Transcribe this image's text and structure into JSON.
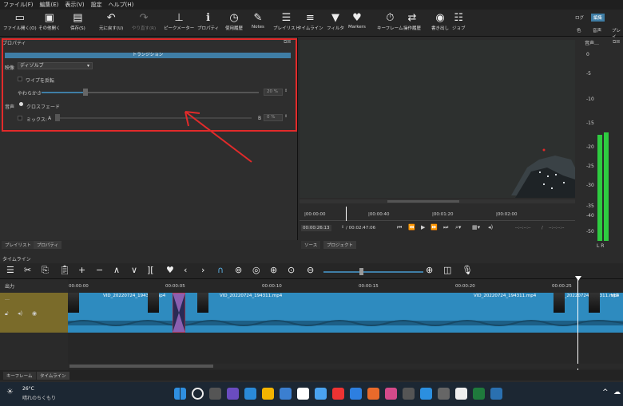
{
  "menu": [
    "ファイル(F)",
    "編集(E)",
    "表示(V)",
    "設定",
    "ヘルプ(H)"
  ],
  "toolbar": [
    {
      "label": "ファイル開く(O)",
      "icon": "folder-icon",
      "ch": "▭"
    },
    {
      "label": "その他開く",
      "icon": "open-other-icon",
      "ch": "▣"
    },
    {
      "label": "保存(S)",
      "icon": "save-icon",
      "ch": "▤"
    },
    {
      "label": "元に戻す(U)",
      "icon": "undo-icon",
      "ch": "↶"
    },
    {
      "label": "やり直す(R)",
      "icon": "redo-icon",
      "ch": "↷"
    },
    {
      "label": "ピークメーター",
      "icon": "peak-meter-icon",
      "ch": "⊥"
    },
    {
      "label": "プロパティ",
      "icon": "properties-icon",
      "ch": "ℹ"
    },
    {
      "label": "使用履歴",
      "icon": "history-icon",
      "ch": "◷"
    },
    {
      "label": "Notes",
      "icon": "notes-icon",
      "ch": "✎"
    },
    {
      "label": "プレイリスト",
      "icon": "playlist-icon",
      "ch": "☰"
    },
    {
      "label": "タイムライン",
      "icon": "timeline-icon",
      "ch": "≡"
    },
    {
      "label": "フィルタ",
      "icon": "filter-icon",
      "ch": "▼"
    },
    {
      "label": "Markers",
      "icon": "markers-icon",
      "ch": "♥"
    },
    {
      "label": "キーフレーム",
      "icon": "keyframe-icon",
      "ch": "⏱"
    },
    {
      "label": "操作履歴",
      "icon": "jobs-history-icon",
      "ch": "⇄"
    },
    {
      "label": "書き出し",
      "icon": "export-icon",
      "ch": "◉"
    },
    {
      "label": "ジョブ",
      "icon": "jobs-icon",
      "ch": "☷"
    }
  ],
  "layout_tabs": {
    "log": "ログ",
    "edit": "編集",
    "color": "色",
    "audio": "音声",
    "player": "プレイ"
  },
  "props": {
    "title": "プロパティ",
    "header": "トランジション",
    "video_label": "映像",
    "dissolve": "ディゾルブ",
    "invert": "ワイプを反転",
    "softness": "やわらかさ",
    "softness_value": "20 %",
    "audio_label": "音声",
    "crossfade": "クロスフェード",
    "mix": "ミックス:",
    "mix_a": "A",
    "mix_b": "B",
    "mix_value": "0 %"
  },
  "meter": {
    "title": "音声…",
    "labels": [
      "0",
      "-5",
      "-10",
      "-15",
      "-20",
      "-25",
      "-30",
      "-35",
      "-40",
      "-50"
    ],
    "lr": "L  R",
    "levels": [
      0.78,
      0.8
    ]
  },
  "player_ruler": [
    "00:00:00",
    "00:00:40",
    "00:01:20",
    "00:02:00"
  ],
  "transport": {
    "position": "00:00:26:13",
    "duration": "/ 00:02:47:06",
    "in": "--:--:--:--",
    "out": "--:--:--:--",
    "sep": "/"
  },
  "left_tabs": [
    "プレイリスト",
    "プロパティ"
  ],
  "right_tabs": [
    "ソース",
    "プロジェクト"
  ],
  "timeline": {
    "title": "タイムライン",
    "output": "出力",
    "ruler": [
      "00:00:00",
      "00:00:05",
      "00:00:10",
      "00:00:15",
      "00:00:20",
      "00:00:25"
    ],
    "clips": [
      "VID_20220724_194311.mp4",
      "VID_20220724_194311.mp4",
      "VID_20220724_194311.mp4",
      "VID_20220724_194311.mp4",
      "VID"
    ]
  },
  "bottom_tabs": [
    "キーフレーム",
    "タイムライン"
  ],
  "weather": {
    "temp": "26°C",
    "desc": "晴れのちくもり"
  }
}
